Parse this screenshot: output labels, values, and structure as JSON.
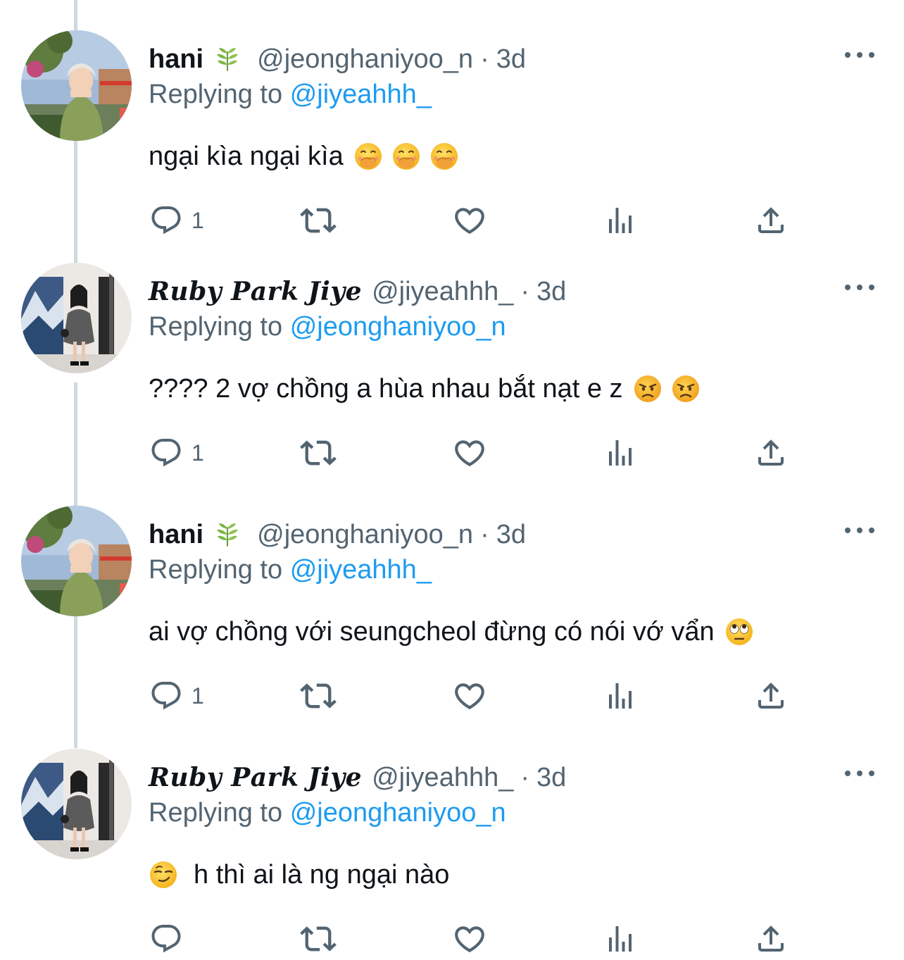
{
  "colors": {
    "accent": "#1d9bf0",
    "secondary_text": "#536471",
    "thread_line": "#cfd9de"
  },
  "tweets": [
    {
      "author": "hani",
      "author_badge_icon": "leaf-emoji-icon",
      "handle": "@jeonghaniyoo_n",
      "separator": "·",
      "time": "3d",
      "replying_label": "Replying to",
      "replying_to": "@jiyeahhh_",
      "text": "ngại kìa ngại kìa",
      "emojis": [
        "hand-over-mouth-emoji-icon",
        "hand-over-mouth-emoji-icon",
        "hand-over-mouth-emoji-icon"
      ],
      "reply_count": "1"
    },
    {
      "author": "𝑹𝒖𝒃𝒚 𝑷𝒂𝒓𝒌 𝑱𝒊𝒚𝒆",
      "handle": "@jiyeahhh_",
      "separator": "·",
      "time": "3d",
      "replying_label": "Replying to",
      "replying_to": "@jeonghaniyoo_n",
      "text": "???? 2 vợ chồng a hùa nhau bắt nạt e z",
      "emojis": [
        "angry-face-emoji-icon",
        "angry-face-emoji-icon"
      ],
      "reply_count": "1"
    },
    {
      "author": "hani",
      "author_badge_icon": "leaf-emoji-icon",
      "handle": "@jeonghaniyoo_n",
      "separator": "·",
      "time": "3d",
      "replying_label": "Replying to",
      "replying_to": "@jiyeahhh_",
      "text": "ai vợ chồng với seungcheol đừng có nói vớ vẩn",
      "emojis": [
        "eye-roll-emoji-icon"
      ],
      "reply_count": "1"
    },
    {
      "author": "𝑹𝒖𝒃𝒚 𝑷𝒂𝒓𝒌 𝑱𝒊𝒚𝒆",
      "handle": "@jiyeahhh_",
      "separator": "·",
      "time": "3d",
      "replying_label": "Replying to",
      "replying_to": "@jeonghaniyoo_n",
      "text": "h thì ai là ng ngại nào",
      "leading_emoji": "smirk-emoji-icon",
      "reply_count": ""
    }
  ]
}
